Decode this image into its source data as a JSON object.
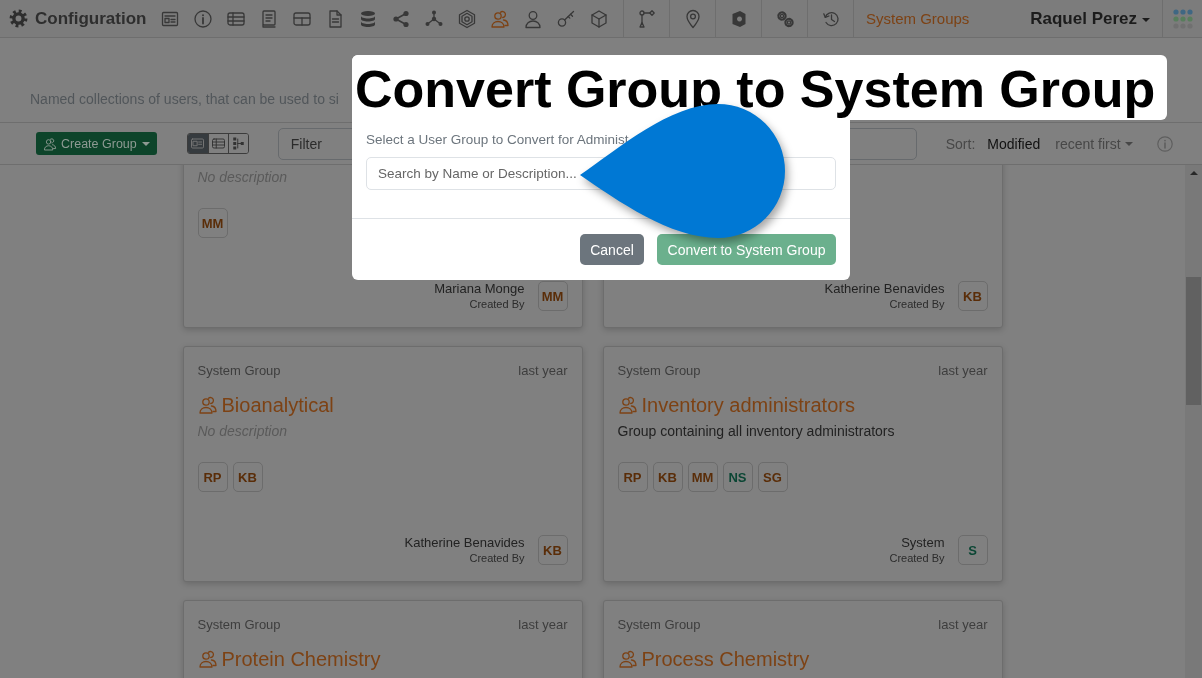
{
  "navbar": {
    "title": "Configuration",
    "tools": [
      {
        "kind": "form",
        "selected": false
      },
      {
        "kind": "info",
        "selected": false
      },
      {
        "kind": "table",
        "selected": false
      },
      {
        "kind": "book",
        "selected": false
      },
      {
        "kind": "grid",
        "selected": false
      },
      {
        "kind": "document",
        "selected": false
      },
      {
        "kind": "database",
        "selected": false
      },
      {
        "kind": "share",
        "selected": false
      },
      {
        "kind": "network",
        "selected": false
      },
      {
        "kind": "badge",
        "selected": false
      },
      {
        "kind": "users",
        "selected": true
      },
      {
        "kind": "user",
        "selected": false
      },
      {
        "kind": "key",
        "selected": false
      },
      {
        "kind": "cube",
        "selected": false
      }
    ],
    "tool_groups": [
      {
        "kind": "branch",
        "selected": false
      },
      {
        "kind": "pin",
        "selected": false
      },
      {
        "kind": "shield",
        "selected": false
      },
      {
        "kind": "gears",
        "selected": false
      },
      {
        "kind": "history",
        "selected": false
      }
    ],
    "current_page": "System Groups",
    "user": "Raquel Perez"
  },
  "header": {
    "description": "Named collections of users, that can be used to si"
  },
  "toolbar": {
    "create_button": "Create Group",
    "views": [
      {
        "kind": "cards",
        "selected": true
      },
      {
        "kind": "table",
        "selected": false
      },
      {
        "kind": "tree",
        "selected": false
      }
    ],
    "filter": {
      "placeholder": "Filter"
    },
    "sort_label": "Sort:",
    "sort_field": "Modified",
    "sort_order": "recent first"
  },
  "cards": [
    {
      "description": "No description",
      "description_missing": true,
      "members": [
        {
          "initials": "MM",
          "color": "#5a2d08"
        }
      ],
      "creator": "Mariana Monge",
      "created_by_label": "Created By",
      "creator_avatar": {
        "initials": "MM",
        "color": "#5a2d08"
      }
    },
    {
      "creator": "Katherine Benavides",
      "created_by_label": "Created By",
      "creator_avatar": {
        "initials": "KB",
        "color": "#5a2d08"
      }
    },
    {
      "type_label": "System Group",
      "age": "last year",
      "title": "Bioanalytical",
      "description": "No description",
      "description_missing": true,
      "members": [
        {
          "initials": "RP",
          "color": "#5a2d08"
        },
        {
          "initials": "KB",
          "color": "#5a2d08"
        }
      ],
      "creator": "Katherine Benavides",
      "created_by_label": "Created By",
      "creator_avatar": {
        "initials": "KB",
        "color": "#5a2d08"
      }
    },
    {
      "type_label": "System Group",
      "age": "last year",
      "title": "Inventory administrators",
      "description": "Group containing all inventory administrators",
      "description_missing": false,
      "members": [
        {
          "initials": "RP",
          "color": "#5a2d08"
        },
        {
          "initials": "KB",
          "color": "#5a2d08"
        },
        {
          "initials": "MM",
          "color": "#5a2d08"
        },
        {
          "initials": "NS",
          "color": "#0b4634"
        },
        {
          "initials": "SG",
          "color": "#5a2d08"
        }
      ],
      "creator": "System",
      "created_by_label": "Created By",
      "creator_avatar": {
        "initials": "S",
        "color": "#0b4634"
      }
    },
    {
      "type_label": "System Group",
      "age": "last year",
      "title": "Protein Chemistry"
    },
    {
      "type_label": "System Group",
      "age": "last year",
      "title": "Process Chemistry"
    }
  ],
  "dialog": {
    "title": "Convert Group to System Group",
    "label": "Select a User Group to Convert for Administ",
    "search": {
      "placeholder": "Search by Name or Description..."
    },
    "buttons": [
      {
        "kind": "secondary",
        "label": "Cancel",
        "disabled": false
      },
      {
        "kind": "primary",
        "label": "Convert to System Group",
        "disabled": true
      }
    ]
  }
}
